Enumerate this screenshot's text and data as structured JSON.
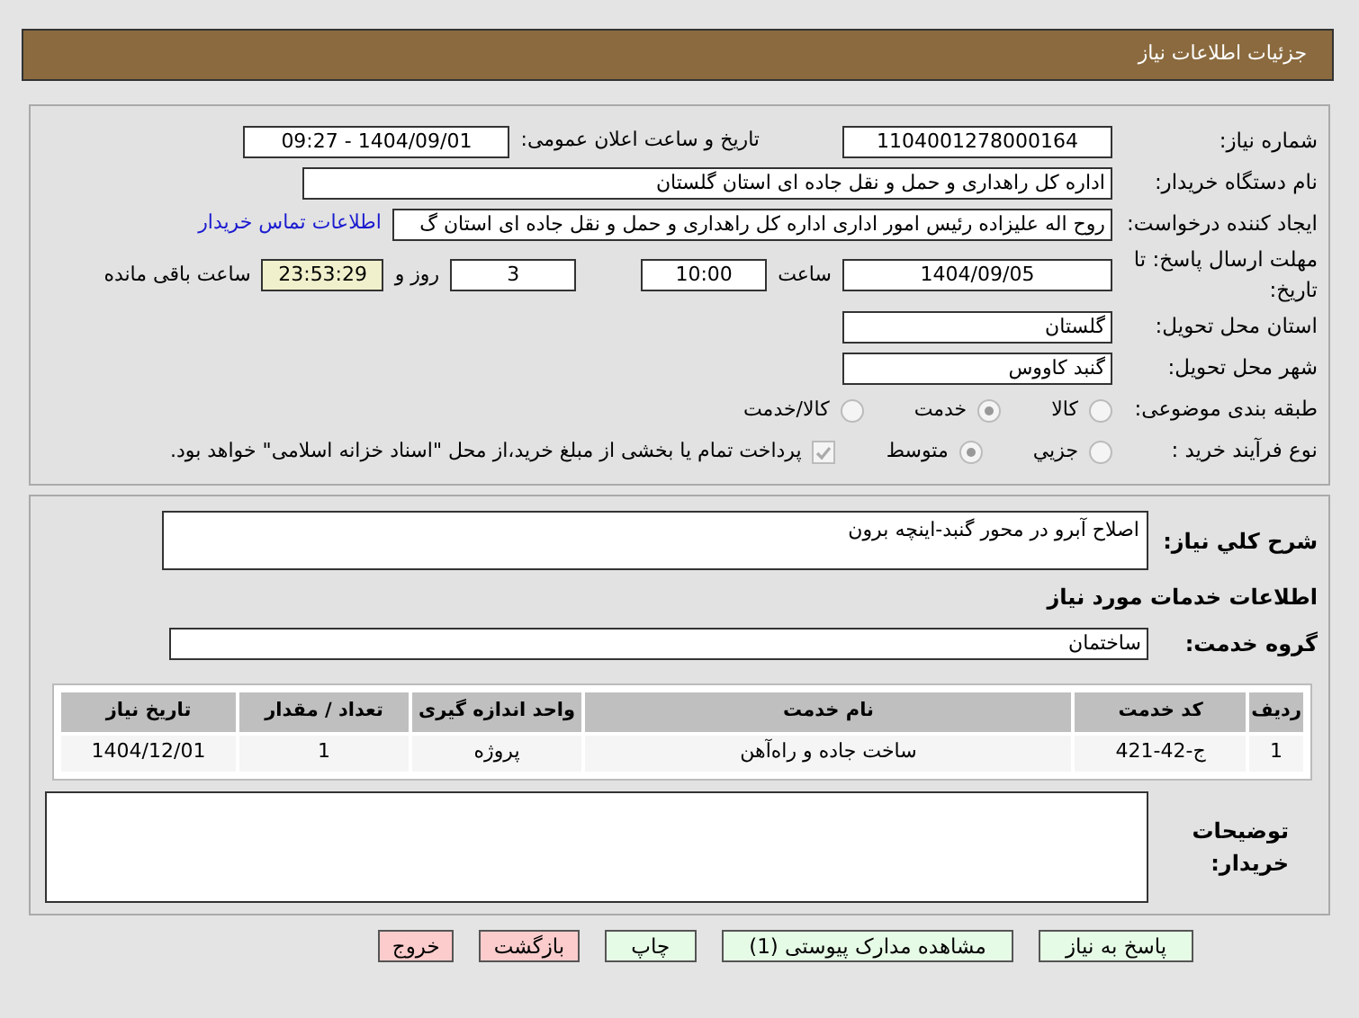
{
  "page_title": "جزئیات اطلاعات نیاز",
  "need_number": {
    "label": "شماره نیاز:",
    "value": "1104001278000164"
  },
  "announce": {
    "label": "تاریخ و ساعت اعلان عمومی:",
    "value": "1404/09/01 - 09:27"
  },
  "buyer_org": {
    "label": "نام دستگاه خریدار:",
    "value": "اداره کل راهداری و حمل و نقل جاده ای استان گلستان"
  },
  "requester": {
    "label": "ایجاد کننده درخواست:",
    "value": "روح اله علیزاده رئیس امور اداری اداره کل راهداری و حمل و نقل جاده ای استان گ",
    "link": "اطلاعات تماس خریدار"
  },
  "deadline": {
    "label": "مهلت ارسال پاسخ: تا تاریخ:",
    "date": "1404/09/05",
    "time_label": "ساعت",
    "time": "10:00",
    "days": "3",
    "days_label": "روز و",
    "remaining": "23:53:29",
    "remaining_label": "ساعت باقی مانده"
  },
  "province": {
    "label": "استان محل تحویل:",
    "value": "گلستان"
  },
  "city": {
    "label": "شهر محل تحویل:",
    "value": "گنبد کاووس"
  },
  "classification": {
    "label": "طبقه بندی موضوعی:",
    "options": [
      {
        "label": "کالا",
        "selected": false
      },
      {
        "label": "خدمت",
        "selected": true
      },
      {
        "label": "کالا/خدمت",
        "selected": false
      }
    ]
  },
  "purchase_type": {
    "label": "نوع فرآیند خرید :",
    "options": [
      {
        "label": "جزیي",
        "selected": false
      },
      {
        "label": "متوسط",
        "selected": true
      }
    ],
    "payment_note": {
      "checked": true,
      "text": "پرداخت تمام یا بخشی از مبلغ خرید،از محل \"اسناد خزانه اسلامی\" خواهد بود."
    }
  },
  "description": {
    "label": "شرح کلي نیاز:",
    "value": "اصلاح آبرو در محور گنبد-اینچه برون"
  },
  "services_heading": "اطلاعات خدمات مورد نیاز",
  "service_group": {
    "label": "گروه خدمت:",
    "value": "ساختمان"
  },
  "table": {
    "columns": [
      "ردیف",
      "کد خدمت",
      "نام خدمت",
      "واحد اندازه گیری",
      "تعداد / مقدار",
      "تاریخ نیاز"
    ],
    "rows": [
      [
        "1",
        "ج-42-421",
        "ساخت جاده و راه‌آهن",
        "پروژه",
        "1",
        "1404/12/01"
      ]
    ]
  },
  "buyer_notes": {
    "label": "توضیحات خریدار:"
  },
  "buttons": [
    {
      "label": "پاسخ به نیاز",
      "kind": "action"
    },
    {
      "label": "مشاهده مدارک پیوستی (1)",
      "kind": "action"
    },
    {
      "label": "چاپ",
      "kind": "action"
    },
    {
      "label": "بازگشت",
      "kind": "exit"
    },
    {
      "label": "خروج",
      "kind": "exit"
    }
  ]
}
